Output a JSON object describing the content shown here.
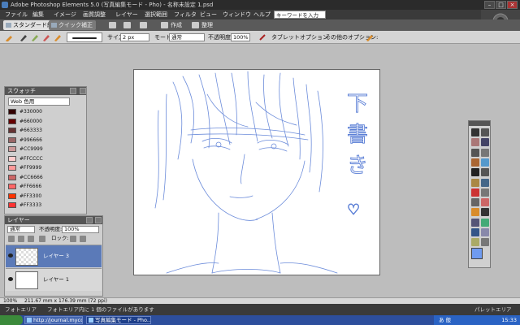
{
  "title_bar": {
    "text": "Adobe Photoshop Elements 5.0 (写真編集モード - Pho) - 名称未設定 1.psd"
  },
  "menu": {
    "items": [
      "ファイル",
      "編集",
      "イメージ",
      "画質調整",
      "レイヤー",
      "選択範囲",
      "フィルタ",
      "ビュー",
      "ウィンドウ",
      "ヘルプ"
    ],
    "keyword_field": "キーワードを入力"
  },
  "mode_bar": {
    "standard": "スタンダード編集",
    "quick": "クイック補正",
    "create": "作成",
    "organize": "整理"
  },
  "options_bar": {
    "size_label": "サイズ:",
    "size_value": "2 px",
    "mode_label": "モード:",
    "mode_value": "通常",
    "opacity_label": "不透明度:",
    "opacity_value": "100%",
    "tablet_label": "タブレットオプション:",
    "other_label": "その他のオプション:"
  },
  "swatches": {
    "title": "スウォッチ",
    "preset": "Web 色用",
    "items": [
      {
        "label": "#330000",
        "color": "#330000"
      },
      {
        "label": "#660000",
        "color": "#660000"
      },
      {
        "label": "#663333",
        "color": "#663333"
      },
      {
        "label": "#996666",
        "color": "#996666"
      },
      {
        "label": "#CC9999",
        "color": "#CC9999"
      },
      {
        "label": "#FFCCCC",
        "color": "#FFCCCC"
      },
      {
        "label": "#FF9999",
        "color": "#FF9999"
      },
      {
        "label": "#CC6666",
        "color": "#CC6666"
      },
      {
        "label": "#FF6666",
        "color": "#FF6666"
      },
      {
        "label": "#FF3300",
        "color": "#FF3300"
      },
      {
        "label": "#FF3333",
        "color": "#FF3333"
      }
    ]
  },
  "layers": {
    "title": "レイヤー",
    "blend_mode": "通常",
    "opacity_label": "不透明度:",
    "opacity_value": "100%",
    "lock_label": "ロック:",
    "rows": [
      {
        "name": "レイヤー 3"
      },
      {
        "name": "レイヤー 1"
      }
    ]
  },
  "status": {
    "zoom": "100%",
    "doc_size": "211.67 mm x 176.39 mm (72 ppi)"
  },
  "bin_bar": {
    "left": "フォトエリア",
    "message": "フォトエリア内に 1 個のファイルがあります",
    "right": "パレットエリア"
  },
  "taskbar": {
    "tasks": [
      "http://journal.mycom...",
      "写真編集モード - Pho..."
    ],
    "ime": "あ 般",
    "clock": "15:33"
  },
  "sketch_text": [
    "下",
    "書",
    "き",
    "♡"
  ],
  "colors": {
    "foreground": "#6f9bf0",
    "sketch_stroke": "#5b7fd6"
  }
}
